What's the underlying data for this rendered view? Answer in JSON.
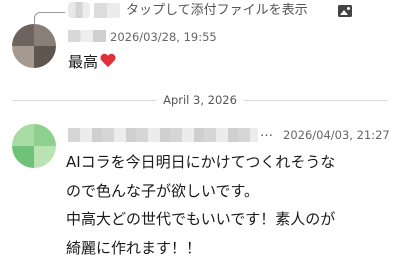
{
  "reply": {
    "text": "タップして添付ファイルを表示",
    "icon": "image-icon"
  },
  "messages": [
    {
      "timestamp": "2026/03/28, 19:55",
      "text": "最高",
      "emoji": "heart-emoji"
    },
    {
      "timestamp": "2026/04/03, 21:27",
      "name_ellipsis": "…",
      "lines": [
        "AIコラを今日明日にかけてつくれそうな",
        "ので色んな子が欲しいです。",
        "中高大どの世代でもいいです！素人のが",
        "綺麗に作れます！！"
      ]
    }
  ],
  "date_divider": "April 3, 2026"
}
